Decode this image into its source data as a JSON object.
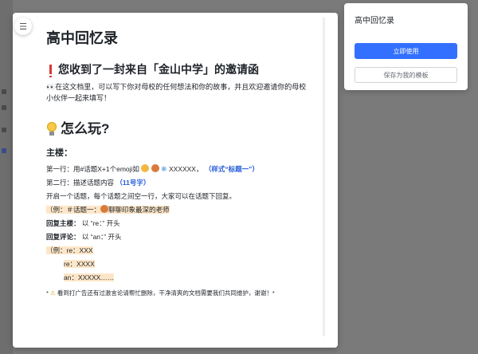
{
  "preview": {
    "toc_icon": "list-icon",
    "title": "高中回忆录",
    "invite_heading": "您收到了一封来自「金山中学」的邀请函",
    "invite_text_prefix": "👀",
    "invite_text": "在这文档里，可以写下你对母校的任何想法和你的故事，并且欢迎邀请你的母校小伙伴一起来填写！",
    "howto_heading": "怎么玩?",
    "main_floor_label": "主楼：",
    "line1_prefix": "第一行：用#话题X+1个emoji如",
    "line1_xs": "XXXXXX，",
    "line1_hint": "（样式“标题一”）",
    "line2_prefix": "第二行：描述话题内容",
    "line2_hint": "（11号字）",
    "line3": "开启一个话题，每个话题之间空一行，大家可以在话题下回复。",
    "example1_prefix": "（例：＃话题一：",
    "example1_text": "聊聊印象最深的老师",
    "reply_main_label": "回复主楼：",
    "reply_main_text": "以 “re：” 开头",
    "reply_comment_label": "回复评论：",
    "reply_comment_text": "以 “an：” 开头",
    "example2_line1": "（例：re：XXX",
    "example2_line2": "re：XXXX",
    "example2_line3": "an：XXXXX……",
    "footer_note_prefix": "*",
    "footer_note_icon": "warning-icon",
    "footer_note": "看到打广告还有过激言论请帮忙删除，干净清爽的文档需要我们共同维护，谢谢！*"
  },
  "side_panel": {
    "title": "高中回忆录",
    "use_button": "立即使用",
    "save_button": "保存为我的模板"
  },
  "colors": {
    "primary": "#3370ff",
    "link_blue": "#245bdb",
    "highlight": "#fde6c8",
    "overlay": "#7d7d7d"
  }
}
